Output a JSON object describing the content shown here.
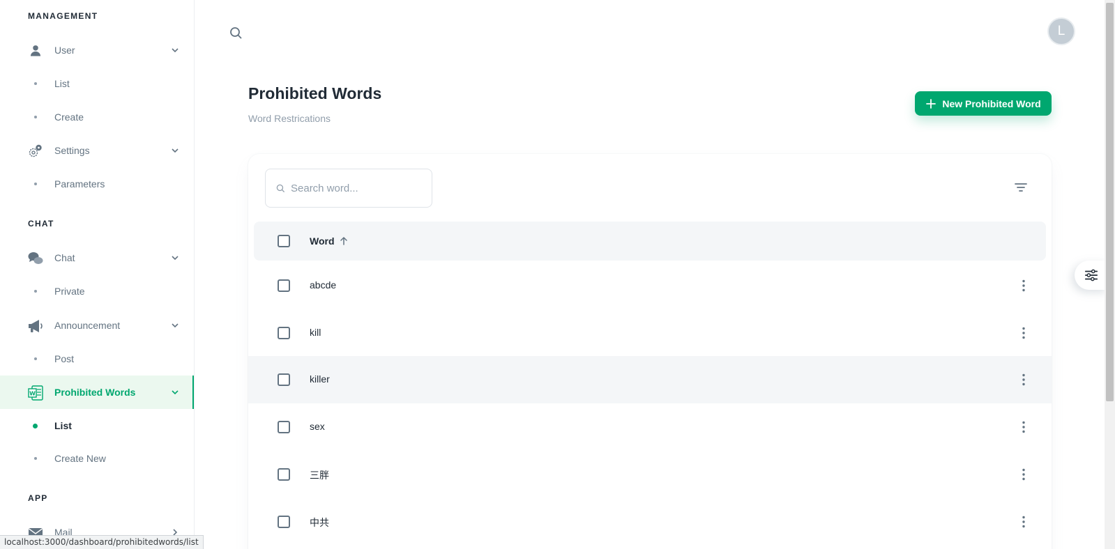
{
  "sidebar": {
    "sections": {
      "management": "MANAGEMENT",
      "chat": "CHAT",
      "app": "APP"
    },
    "items": {
      "user": {
        "label": "User",
        "icon": "user-icon"
      },
      "user_list": "List",
      "user_create": "Create",
      "settings": {
        "label": "Settings",
        "icon": "gear-icon"
      },
      "settings_parameters": "Parameters",
      "chat": {
        "label": "Chat",
        "icon": "chat-bubbles-icon"
      },
      "chat_private": "Private",
      "announcement": {
        "label": "Announcement",
        "icon": "megaphone-icon"
      },
      "announcement_post": "Post",
      "prohibited_words": {
        "label": "Prohibited Words",
        "icon": "word-document-icon"
      },
      "prohibited_list": "List",
      "prohibited_create": "Create New",
      "mail": {
        "label": "Mail",
        "icon": "mail-icon"
      }
    }
  },
  "status_url": "localhost:3000/dashboard/prohibitedwords/list",
  "header": {
    "avatar_initial": "L"
  },
  "page": {
    "title": "Prohibited Words",
    "breadcrumb": "Word Restrications",
    "new_button": "New Prohibited Word"
  },
  "table": {
    "search_placeholder": "Search word...",
    "column_word": "Word",
    "rows": [
      "abcde",
      "kill",
      "killer",
      "sex",
      "三胖",
      "中共"
    ]
  },
  "colors": {
    "accent": "#00a76f",
    "text_primary": "#212b36",
    "text_secondary": "#637381"
  }
}
